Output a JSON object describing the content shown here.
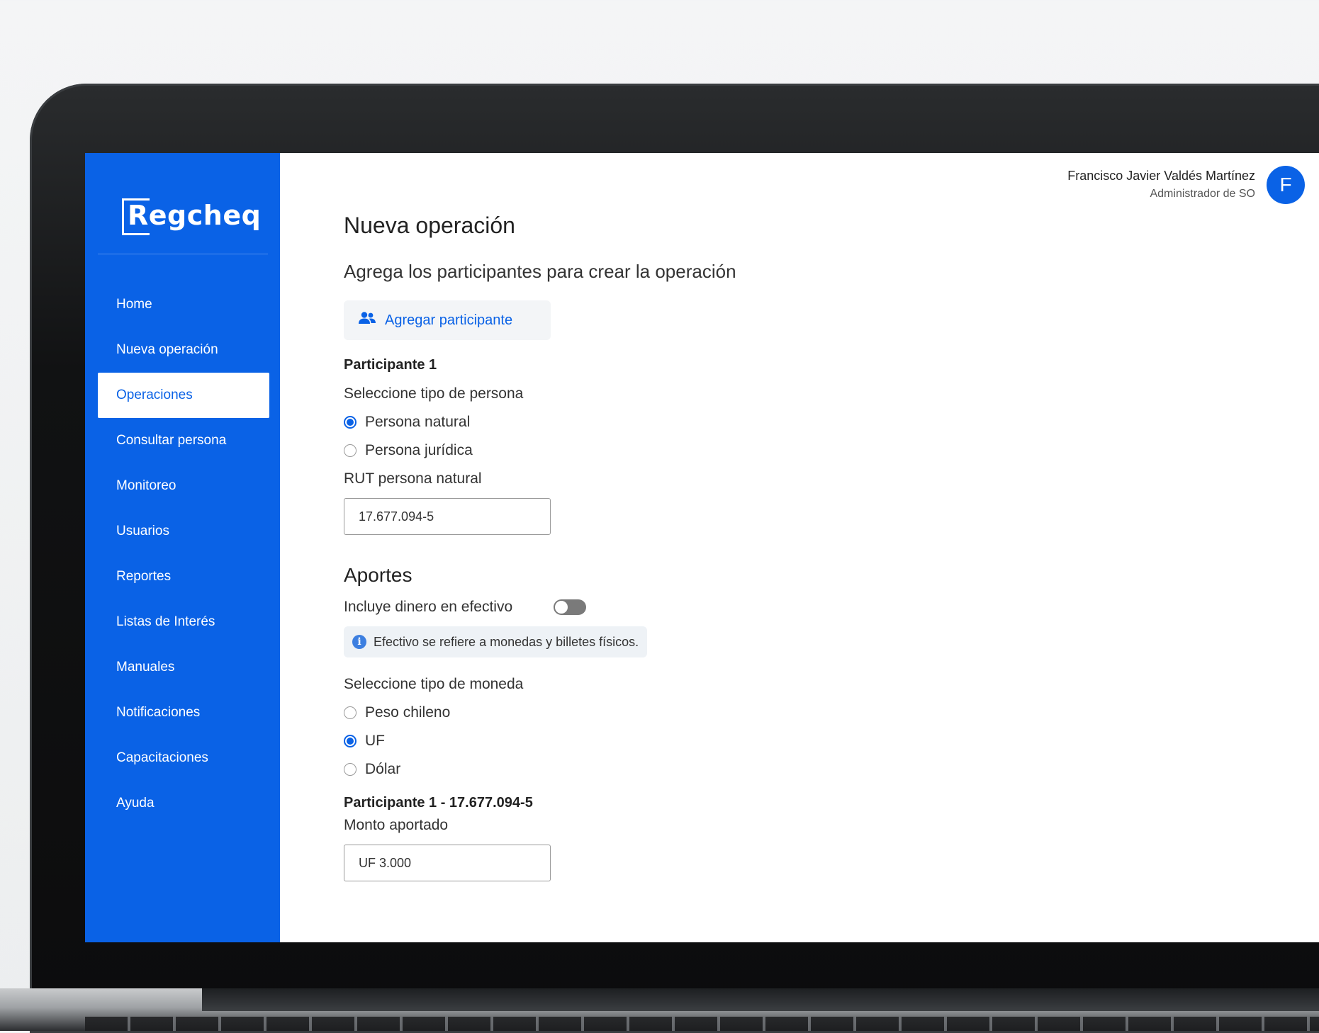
{
  "sidebar": {
    "logo": "Regcheq",
    "items": [
      {
        "label": "Home"
      },
      {
        "label": "Nueva operación"
      },
      {
        "label": "Operaciones",
        "active": true
      },
      {
        "label": "Consultar persona"
      },
      {
        "label": "Monitoreo"
      },
      {
        "label": "Usuarios"
      },
      {
        "label": "Reportes"
      },
      {
        "label": "Listas de Interés"
      },
      {
        "label": "Manuales"
      },
      {
        "label": "Notificaciones"
      },
      {
        "label": "Capacitaciones"
      },
      {
        "label": "Ayuda"
      }
    ]
  },
  "header": {
    "user_name": "Francisco Javier Valdés Martínez",
    "user_role": "Administrador de SO",
    "avatar_initial": "F"
  },
  "main": {
    "title": "Nueva operación",
    "subtitle": "Agrega los participantes para crear la operación",
    "add_participant_label": "Agregar participante",
    "participant_heading": "Participante 1",
    "person_type_label": "Seleccione tipo de persona",
    "person_types": [
      {
        "label": "Persona natural",
        "checked": true
      },
      {
        "label": "Persona jurídica",
        "checked": false
      }
    ],
    "rut_label": "RUT persona natural",
    "rut_value": "17.677.094-5",
    "aportes_title": "Aportes",
    "cash_label": "Incluye dinero en efectivo",
    "cash_enabled": false,
    "cash_info": "Efectivo se refiere a monedas y billetes físicos.",
    "currency_label": "Seleccione tipo de moneda",
    "currencies": [
      {
        "label": "Peso chileno",
        "checked": false
      },
      {
        "label": "UF",
        "checked": true
      },
      {
        "label": "Dólar",
        "checked": false
      }
    ],
    "participant_summary": "Participante 1 - 17.677.094-5",
    "amount_label": "Monto aportado",
    "amount_value": "UF 3.000"
  },
  "colors": {
    "accent": "#0a62e6",
    "sidebar_bg": "#0a62e6"
  },
  "icons": {
    "add_participant": "users-icon",
    "info": "info-icon"
  }
}
